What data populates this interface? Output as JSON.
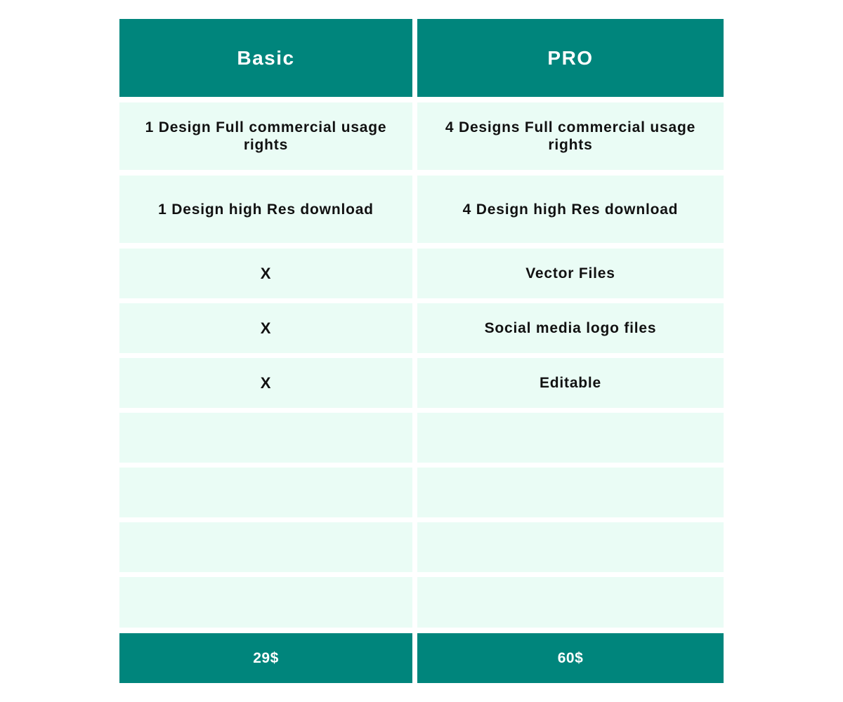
{
  "colors": {
    "header_bg": "#00857c",
    "cell_bg": "#eafcf5",
    "text_dark": "#111111",
    "text_light": "#ffffff"
  },
  "plans": [
    {
      "name": "Basic",
      "features": [
        "1 Design Full commercial usage rights",
        "1 Design high Res download",
        "X",
        "X",
        "X",
        "",
        "",
        "",
        ""
      ],
      "price": "29$"
    },
    {
      "name": "PRO",
      "features": [
        "4 Designs Full commercial usage rights",
        "4 Design high Res download",
        "Vector Files",
        "Social media logo files",
        "Editable",
        "",
        "",
        "",
        ""
      ],
      "price": "60$"
    }
  ]
}
